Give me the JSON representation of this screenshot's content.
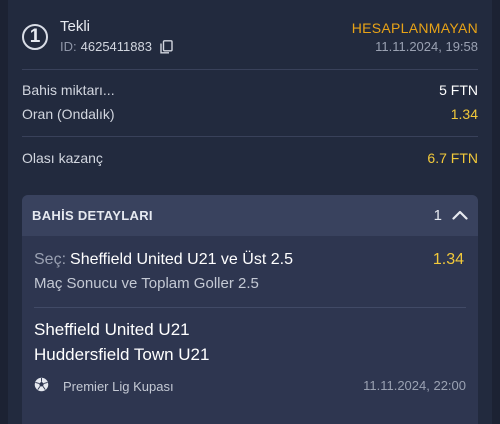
{
  "bet": {
    "number": "1",
    "type": "Tekli",
    "id_prefix": "ID:",
    "id": "4625411883",
    "status": "HESAPLANMAYAN",
    "date": "11.11.2024, 19:58"
  },
  "summary": {
    "stake_label": "Bahis miktarı...",
    "stake_value": "5 FTN",
    "odds_label": "Oran (Ondalık)",
    "odds_value": "1.34",
    "potential_label": "Olası kazanç",
    "potential_value": "6.7 FTN"
  },
  "details": {
    "title": "BAHİS DETAYLARI",
    "count": "1",
    "selection_prefix": "Seç:",
    "selection": "Sheffield United U21 ve Üst 2.5",
    "selection_odds": "1.34",
    "market": "Maç Sonucu ve Toplam Goller 2.5",
    "home_team": "Sheffield United U21",
    "away_team": "Huddersfield Town U21",
    "league": "Premier Lig Kupası",
    "match_date": "11.11.2024, 22:00",
    "league_icon": "soccer-ball-icon"
  },
  "colors": {
    "background": "#1c2233",
    "status": "#e8a317",
    "accent_yellow": "#f2c93a"
  }
}
